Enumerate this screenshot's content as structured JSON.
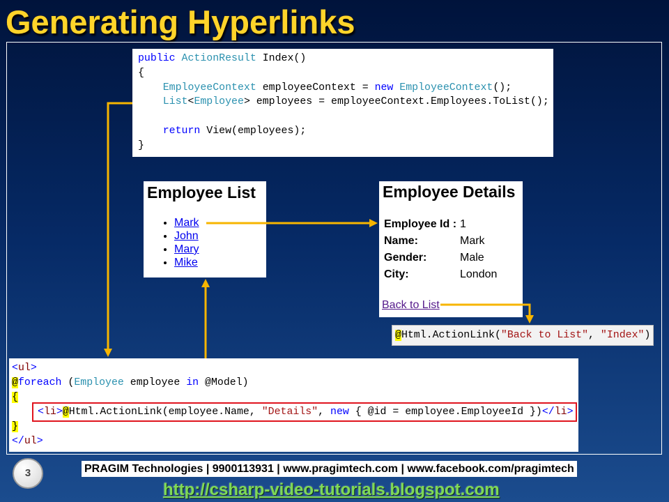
{
  "slide": {
    "title": "Generating Hyperlinks",
    "page_number": "3",
    "footer_text": "PRAGIM Technologies | 9900113931 | www.pragimtech.com | www.facebook.com/pragimtech",
    "url": "http://csharp-video-tutorials.blogspot.com"
  },
  "controller_code": {
    "lines": [
      [
        {
          "t": "public",
          "c": "#0000ff"
        },
        {
          "t": " ActionResult",
          "c": "#2b91af"
        },
        {
          "t": " Index()"
        }
      ],
      [
        {
          "t": "{"
        }
      ],
      [
        {
          "t": "    EmployeeContext",
          "c": "#2b91af"
        },
        {
          "t": " employeeContext = "
        },
        {
          "t": "new",
          "c": "#0000ff"
        },
        {
          "t": " EmployeeContext",
          "c": "#2b91af"
        },
        {
          "t": "();"
        }
      ],
      [
        {
          "t": "    List",
          "c": "#2b91af"
        },
        {
          "t": "<"
        },
        {
          "t": "Employee",
          "c": "#2b91af"
        },
        {
          "t": "> employees = employeeContext.Employees.ToList();"
        }
      ],
      [],
      [
        {
          "t": "    return",
          "c": "#0000ff"
        },
        {
          "t": " View(employees);"
        }
      ],
      [
        {
          "t": "}"
        }
      ]
    ]
  },
  "employee_list": {
    "title": "Employee List",
    "items": [
      "Mark",
      "John",
      "Mary",
      "Mike"
    ]
  },
  "employee_details": {
    "title": "Employee Details",
    "rows": [
      {
        "label": "Employee Id :",
        "value": "1"
      },
      {
        "label": "Name:",
        "value": "Mark"
      },
      {
        "label": "Gender:",
        "value": "Male"
      },
      {
        "label": "City:",
        "value": "London"
      }
    ],
    "back_link": "Back to List"
  },
  "back_link_code": {
    "tokens": [
      {
        "t": "@",
        "bg": "#ffff00"
      },
      {
        "t": "Html.ActionLink("
      },
      {
        "t": "\"Back to List\"",
        "c": "#a31515"
      },
      {
        "t": ", "
      },
      {
        "t": "\"Index\"",
        "c": "#a31515"
      },
      {
        "t": ")"
      }
    ]
  },
  "view_code": {
    "lines_top": [
      [
        {
          "t": "<",
          "c": "#0000ff"
        },
        {
          "t": "ul",
          "c": "#800000"
        },
        {
          "t": ">",
          "c": "#0000ff"
        }
      ],
      [
        {
          "t": "@",
          "bg": "#ffff00"
        },
        {
          "t": "foreach",
          "c": "#0000ff"
        },
        {
          "t": " ("
        },
        {
          "t": "Employee",
          "c": "#2b91af"
        },
        {
          "t": " employee "
        },
        {
          "t": "in",
          "c": "#0000ff"
        },
        {
          "t": " @Model)"
        }
      ],
      [
        {
          "t": "{",
          "bg": "#ffff00"
        }
      ]
    ],
    "highlighted_line": [
      {
        "t": "<",
        "c": "#0000ff"
      },
      {
        "t": "li",
        "c": "#800000"
      },
      {
        "t": ">",
        "c": "#0000ff"
      },
      {
        "t": "@",
        "bg": "#ffff00"
      },
      {
        "t": "Html.ActionLink(employee.Name, "
      },
      {
        "t": "\"Details\"",
        "c": "#a31515"
      },
      {
        "t": ", "
      },
      {
        "t": "new",
        "c": "#0000ff"
      },
      {
        "t": " { @id = employee.EmployeeId })"
      },
      {
        "t": "</",
        "c": "#0000ff"
      },
      {
        "t": "li",
        "c": "#800000"
      },
      {
        "t": ">",
        "c": "#0000ff"
      }
    ],
    "lines_bottom": [
      [
        {
          "t": "}",
          "bg": "#ffff00"
        }
      ],
      [
        {
          "t": "</",
          "c": "#0000ff"
        },
        {
          "t": "ul",
          "c": "#800000"
        },
        {
          "t": ">",
          "c": "#0000ff"
        }
      ]
    ]
  },
  "colors": {
    "title": "#ffd42a",
    "arrow": "#f7b500",
    "link": "#0000ee",
    "visited_link": "#551a8b",
    "highlight_border": "#e0141e",
    "url": "#7ed957",
    "background_top": "#00133b",
    "background_bottom": "#1b4c8e"
  }
}
